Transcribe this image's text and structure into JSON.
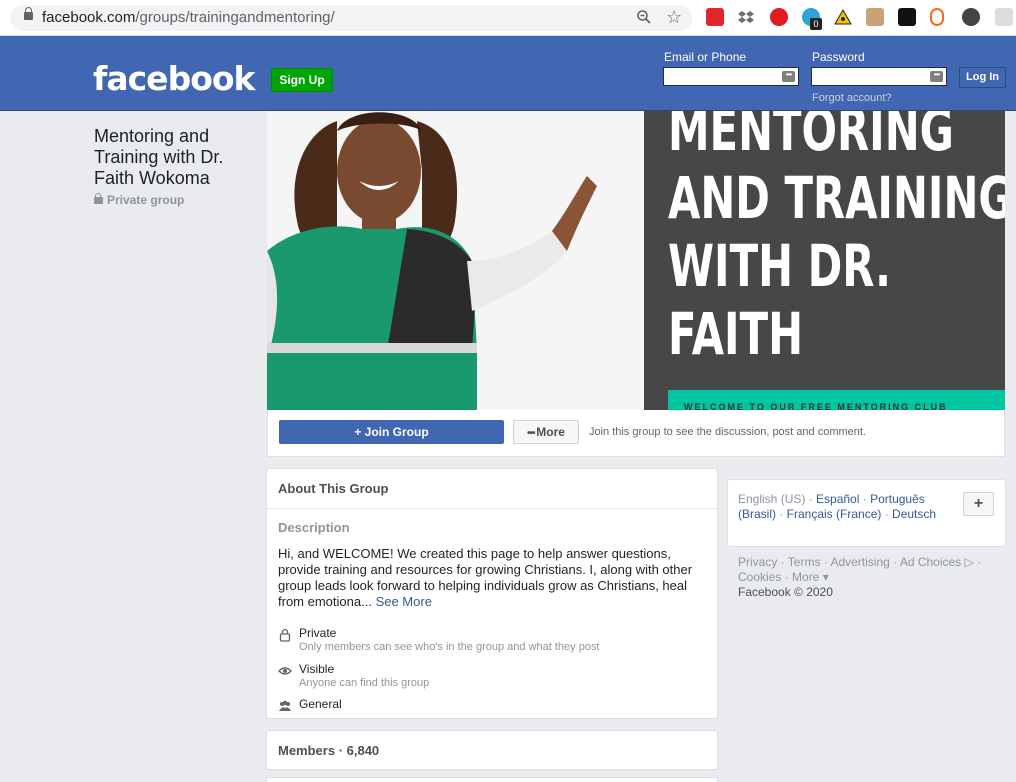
{
  "browser": {
    "url_host": "facebook.com",
    "url_path": "/groups/trainingandmentoring/",
    "extension_badge": "0"
  },
  "header": {
    "logo": "facebook",
    "signup_label": "Sign Up",
    "email_label": "Email or Phone",
    "password_label": "Password",
    "forgot_label": "Forgot account?",
    "login_label": "Log In"
  },
  "group": {
    "name": "Mentoring and Training with Dr. Faith Wokoma",
    "privacy": "Private group"
  },
  "cover": {
    "lines": [
      "MENTORING",
      "AND TRAINING",
      "WITH DR.",
      "FAITH"
    ],
    "band_text": "WELCOME TO OUR FREE MENTORING CLUB"
  },
  "actions": {
    "join_label": "Join Group",
    "more_label": "More",
    "hint": "Join this group to see the discussion, post and comment."
  },
  "about": {
    "title": "About This Group",
    "description_label": "Description",
    "description": "Hi, and WELCOME! We created this page to help answer questions, provide training and resources for growing Christians. I, along with other group leads look forward to helping individuals grow as Christians, heal from emotiona...",
    "see_more": "See More",
    "private_title": "Private",
    "private_sub": "Only members can see who's in the group and what they post",
    "visible_title": "Visible",
    "visible_sub": "Anyone can find this group",
    "general": "General"
  },
  "members": {
    "label": "Members · 6,840"
  },
  "languages": {
    "current": "English (US) · ",
    "links": [
      "Español",
      "Português (Brasil)",
      "Français (France)",
      "Deutsch"
    ],
    "plus": "+"
  },
  "footer": {
    "links": "Privacy · Terms · Advertising · Ad Choices ▷ · Cookies · More ▾",
    "copyright": "Facebook © 2020"
  },
  "colors": {
    "brand": "#4267b2",
    "signup": "#00a400",
    "cover_band": "#00c5a1"
  }
}
